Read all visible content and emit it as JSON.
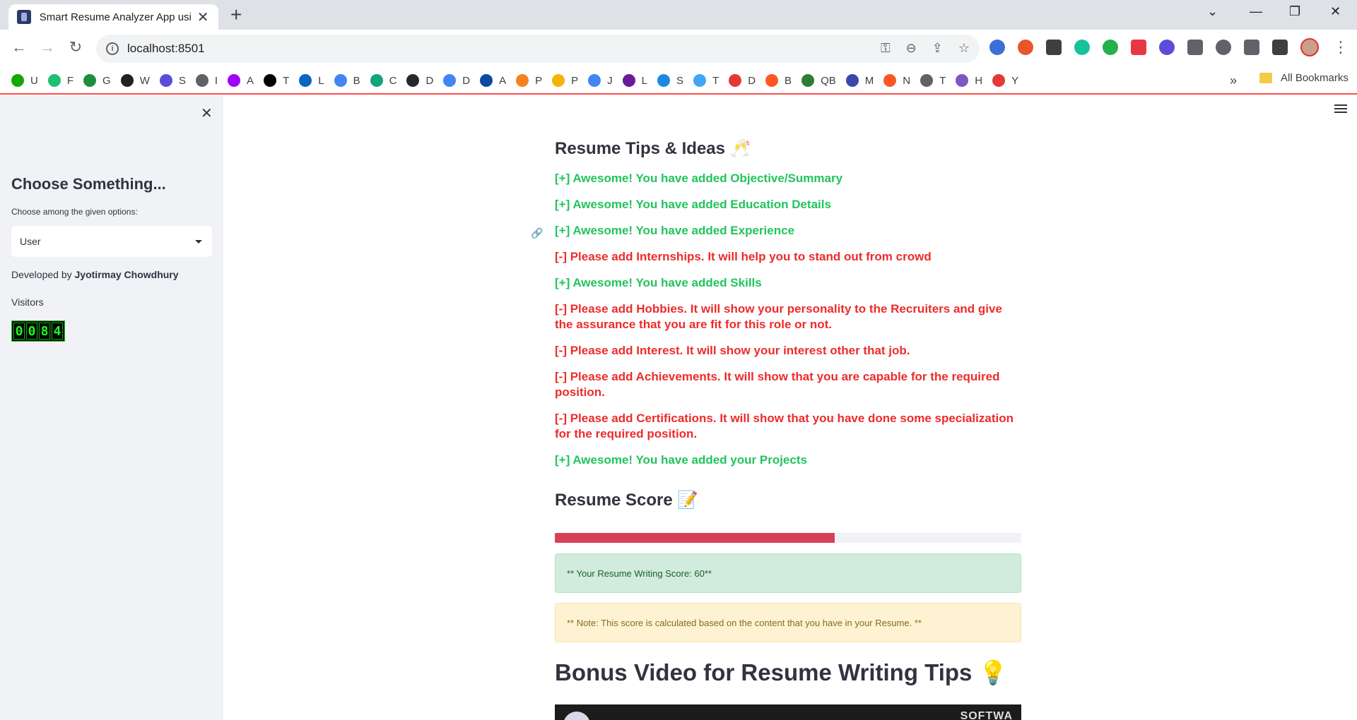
{
  "browser": {
    "tab_title": "Smart Resume Analyzer App using",
    "tab_close": "✕",
    "new_tab": "+",
    "url": "localhost:8501",
    "bookmarks": [
      {
        "label": "U",
        "icon": "upwork-icon",
        "color": "#14a800"
      },
      {
        "label": "F",
        "icon": "fiverr-icon",
        "color": "#1dbf73"
      },
      {
        "label": "G",
        "icon": "bookmark-g-icon",
        "color": "#1e8e3e"
      },
      {
        "label": "W",
        "icon": "bookmark-w-icon",
        "color": "#222222"
      },
      {
        "label": "S",
        "icon": "bookmark-s-icon",
        "color": "#5b4dd8"
      },
      {
        "label": "I",
        "icon": "globe-icon",
        "color": "#5f6368"
      },
      {
        "label": "A",
        "icon": "arrow-icon",
        "color": "#a100ff"
      },
      {
        "label": "T",
        "icon": "x-icon",
        "color": "#000000"
      },
      {
        "label": "L",
        "icon": "linkedin-icon",
        "color": "#0a66c2"
      },
      {
        "label": "B",
        "icon": "sparkle-icon",
        "color": "#4285f4"
      },
      {
        "label": "C",
        "icon": "chatgpt-icon",
        "color": "#10a37f"
      },
      {
        "label": "D",
        "icon": "github-icon",
        "color": "#24292f"
      },
      {
        "label": "D",
        "icon": "docs-icon",
        "color": "#4285f4"
      },
      {
        "label": "A",
        "icon": "bookmark-a-icon",
        "color": "#0d47a1"
      },
      {
        "label": "P",
        "icon": "cloud-icon",
        "color": "#f6821f"
      },
      {
        "label": "P",
        "icon": "chart-icon",
        "color": "#f4b400"
      },
      {
        "label": "J",
        "icon": "docs-icon",
        "color": "#4285f4"
      },
      {
        "label": "L",
        "icon": "bookmark-l-icon",
        "color": "#6a1b9a"
      },
      {
        "label": "S",
        "icon": "bookmark-s2-icon",
        "color": "#1e88e5"
      },
      {
        "label": "T",
        "icon": "upload-icon",
        "color": "#42a5f5"
      },
      {
        "label": "D",
        "icon": "bookmark-d-icon",
        "color": "#e53935"
      },
      {
        "label": "B",
        "icon": "blogger-icon",
        "color": "#ff5722"
      },
      {
        "label": "QB",
        "icon": "bookmark-qb-icon",
        "color": "#2e7d32"
      },
      {
        "label": "M",
        "icon": "mail-icon",
        "color": "#3949ab"
      },
      {
        "label": "N",
        "icon": "bookmark-n-icon",
        "color": "#ff5722"
      },
      {
        "label": "T",
        "icon": "globe-icon",
        "color": "#5f6368"
      },
      {
        "label": "H",
        "icon": "bookmark-h-icon",
        "color": "#7e57c2"
      },
      {
        "label": "Y",
        "icon": "bookmark-y-icon",
        "color": "#e53935"
      }
    ],
    "bookmarks_more": "»",
    "all_bookmarks": "All Bookmarks"
  },
  "sidebar": {
    "close": "✕",
    "title": "Choose Something...",
    "select_label": "Choose among the given options:",
    "select_value": "User",
    "developed_prefix": "Developed by ",
    "developer": "Jyotirmay Chowdhury",
    "visitors_label": "Visitors",
    "visitor_digits": [
      "0",
      "0",
      "8",
      "4"
    ]
  },
  "main": {
    "tips_heading": "Resume Tips & Ideas 🥂",
    "tips": [
      {
        "text": "[+] Awesome! You have added Objective/Summary",
        "status": "good"
      },
      {
        "text": "[+] Awesome! You have added Education Details",
        "status": "good"
      },
      {
        "text": "[+] Awesome! You have added Experience",
        "status": "good"
      },
      {
        "text": "[-] Please add Internships. It will help you to stand out from crowd",
        "status": "bad"
      },
      {
        "text": "[+] Awesome! You have added Skills",
        "status": "good"
      },
      {
        "text": "[-] Please add Hobbies. It will show your personality to the Recruiters and give the assurance that you are fit for this role or not.",
        "status": "bad"
      },
      {
        "text": "[-] Please add Interest. It will show your interest other that job.",
        "status": "bad"
      },
      {
        "text": "[-] Please add Achievements. It will show that you are capable for the required position.",
        "status": "bad"
      },
      {
        "text": "[-] Please add Certifications. It will show that you have done some specialization for the required position.",
        "status": "bad"
      },
      {
        "text": "[+] Awesome! You have added your Projects",
        "status": "good"
      }
    ],
    "score_heading": "Resume Score 📝",
    "score_progress": 0.6,
    "score_message": "** Your Resume Writing Score: 60**",
    "note_message": "** Note: This score is calculated based on the content that you have in your Resume. **",
    "bonus_heading": "Bonus Video for Resume Writing Tips 💡",
    "video_brand": "SOFTWA"
  },
  "colors": {
    "good": "#21c45d",
    "bad": "#ee2b2b",
    "progress": "#d8405a",
    "accent_line": "#ff4b4b"
  }
}
